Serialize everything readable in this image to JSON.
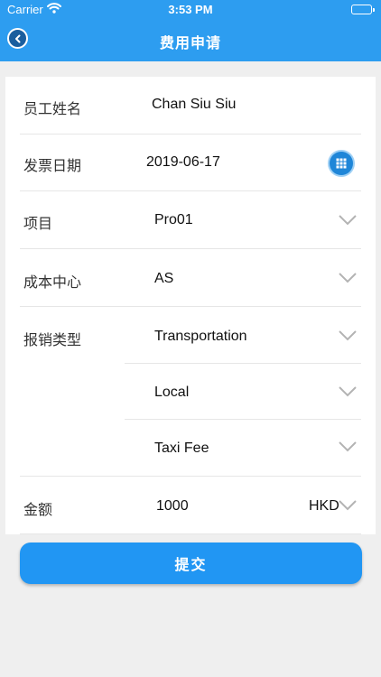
{
  "status_bar": {
    "carrier": "Carrier",
    "time": "3:53 PM"
  },
  "header": {
    "title": "费用申请",
    "back_icon": "back-arrow-icon"
  },
  "form": {
    "employee_name": {
      "label": "员工姓名",
      "value": "Chan Siu Siu"
    },
    "invoice_date": {
      "label": "发票日期",
      "value": "2019-06-17",
      "picker_icon": "calendar-grid-icon"
    },
    "project": {
      "label": "项目",
      "value": "Pro01"
    },
    "cost_center": {
      "label": "成本中心",
      "value": "AS"
    },
    "expense_type": {
      "label": "报销类型",
      "levels": [
        "Transportation",
        "Local",
        "Taxi Fee"
      ]
    },
    "amount": {
      "label": "金额",
      "value": "1000",
      "currency": "HKD"
    }
  },
  "submit_label": "提交",
  "colors": {
    "header": "#2d9df0",
    "button": "#2196f3",
    "background": "#efefef",
    "chevron": "#b3b3b3"
  }
}
